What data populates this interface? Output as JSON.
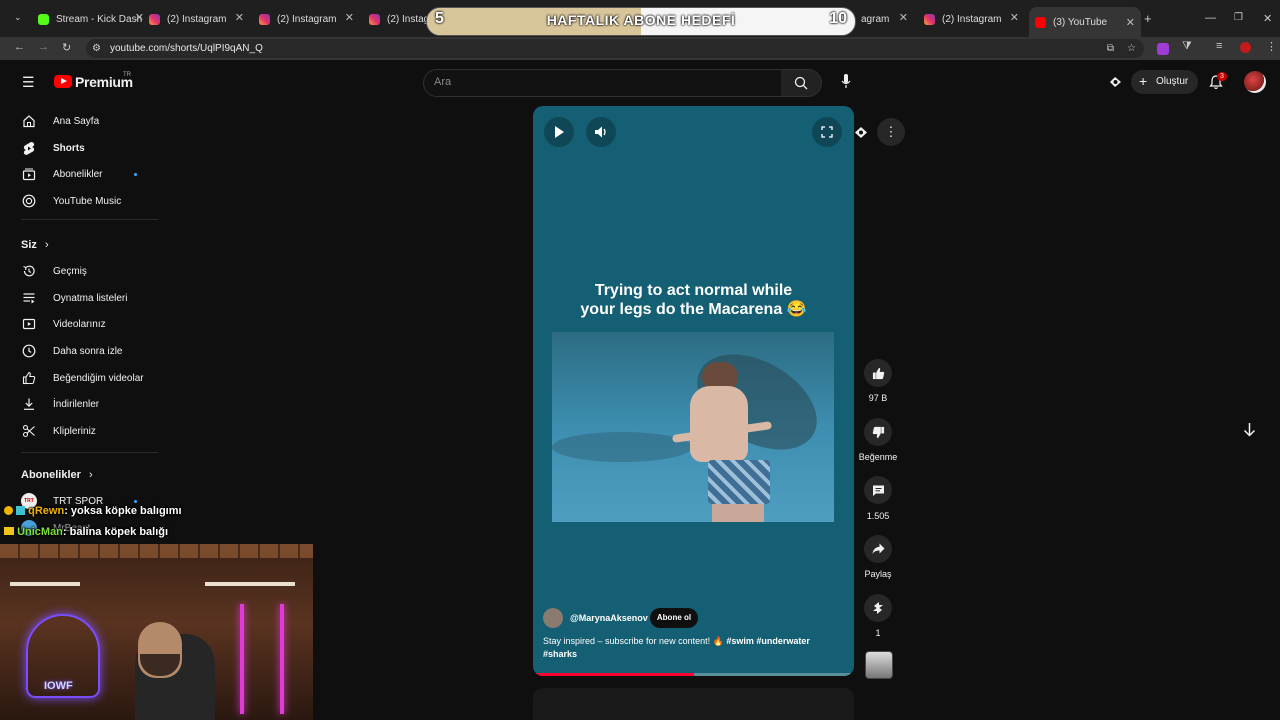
{
  "browser": {
    "tabs": [
      {
        "title": "Stream - Kick Dash"
      },
      {
        "title": "(2) Instagram"
      },
      {
        "title": "(2) Instagram"
      },
      {
        "title": "(2) Instagram"
      },
      {
        "title": "(2) Instagram"
      },
      {
        "title": "(2) Instagram"
      },
      {
        "title": "(2) Instagram"
      },
      {
        "title": "(3) YouTube"
      }
    ],
    "url": "youtube.com/shorts/UqlPI9qAN_Q"
  },
  "overlay": {
    "goal_title": "HAFTALIK ABONE HEDEFİ",
    "current": "5",
    "target": "10",
    "progress": 0.5
  },
  "header": {
    "logo_text": "Premium",
    "logo_badge": "TR",
    "search_placeholder": "Ara",
    "create_label": "Oluştur",
    "notif_count": "3"
  },
  "sidebar": {
    "main": [
      {
        "label": "Ana Sayfa",
        "icon": "home-icon"
      },
      {
        "label": "Shorts",
        "icon": "shorts-icon"
      },
      {
        "label": "Abonelikler",
        "icon": "subscriptions-icon"
      },
      {
        "label": "YouTube Music",
        "icon": "music-icon"
      }
    ],
    "you_title": "Siz",
    "you": [
      {
        "label": "Geçmiş",
        "icon": "history-icon"
      },
      {
        "label": "Oynatma listeleri",
        "icon": "playlist-icon"
      },
      {
        "label": "Videolarınız",
        "icon": "video-icon"
      },
      {
        "label": "Daha sonra izle",
        "icon": "clock-icon"
      },
      {
        "label": "Beğendiğim videolar",
        "icon": "thumbs-up-icon"
      },
      {
        "label": "İndirilenler",
        "icon": "download-icon"
      },
      {
        "label": "Klipleriniz",
        "icon": "scissors-icon"
      }
    ],
    "subs_title": "Abonelikler",
    "subs": [
      {
        "label": "TRT SPOR",
        "avatar": "TRT"
      },
      {
        "label": "MrBeast"
      }
    ]
  },
  "chat": [
    {
      "user": "qRewn",
      "message": ": yoksa köpke balıgımı",
      "color": "#f0b400"
    },
    {
      "user": "UnicMan",
      "message": ": balina köpek balığı",
      "color": "#7ee03c"
    }
  ],
  "short": {
    "caption_line1": "Trying to act normal while",
    "caption_line2": "your legs do the Macarena 😂",
    "channel": "@MarynaAksenov",
    "subscribe_label": "Abone ol",
    "description": "Stay inspired – subscribe  for new content! 🔥",
    "hashtags1": "#swim #underwater",
    "hashtags2": "#sharks",
    "progress": 0.5
  },
  "actions": {
    "likes": "97 B",
    "dislike_label": "Beğenme",
    "comments": "1.505",
    "share_label": "Paylaş",
    "remix_count": "1"
  },
  "colors": {
    "youtube_red": "#ff0000",
    "player_bg": "#145f73",
    "progress_red": "#ff0033"
  }
}
